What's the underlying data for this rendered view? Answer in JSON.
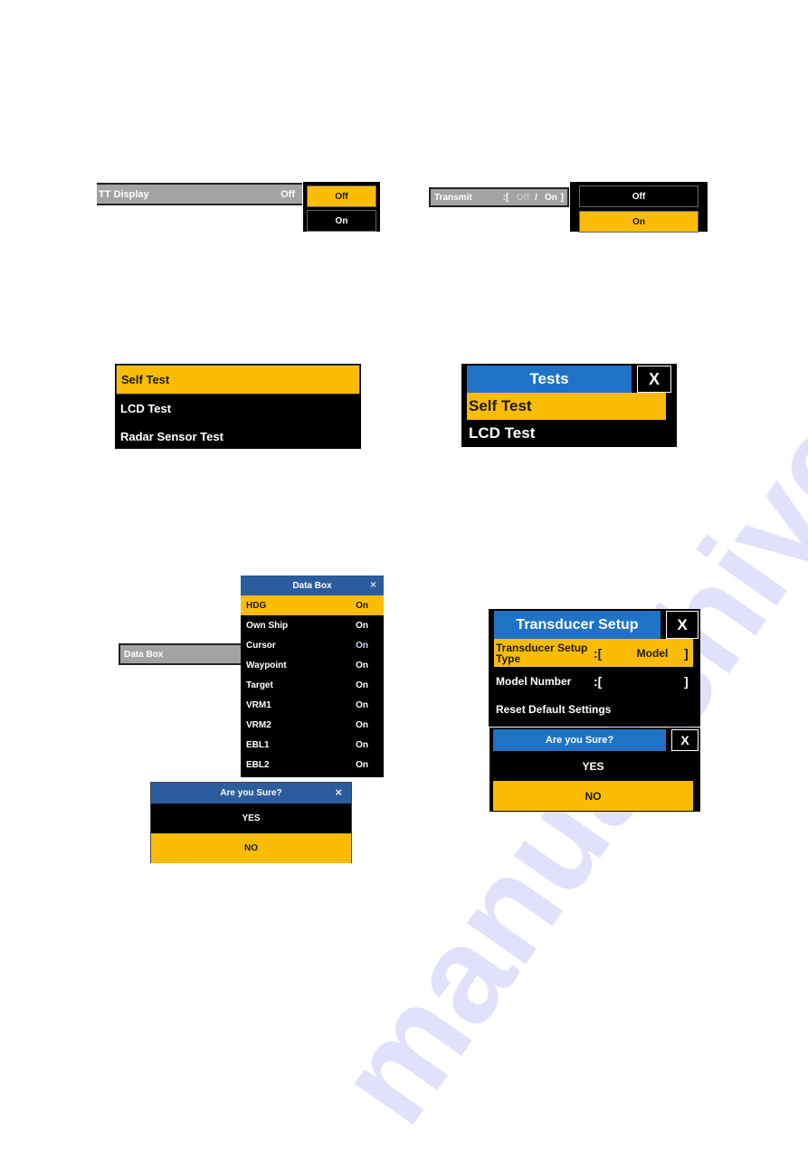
{
  "watermark": "manualshive.com",
  "colors": {
    "selected": "#fbbc05",
    "header_blue": "#1f73c6",
    "header_navy": "#2a5c9e",
    "bar_gray": "#a3a3a3"
  },
  "tt_display": {
    "label": "TT Display",
    "value": "Off",
    "options": [
      {
        "label": "Off",
        "selected": true
      },
      {
        "label": "On",
        "selected": false
      }
    ]
  },
  "transmit": {
    "label": "Transmit",
    "open_bracket": ":[",
    "option_off": "Off",
    "separator": "/",
    "option_on": "On",
    "close_bracket": "]",
    "options": [
      {
        "label": "Off",
        "selected": false
      },
      {
        "label": "On",
        "selected": true
      }
    ]
  },
  "test_list": {
    "items": [
      {
        "label": "Self Test",
        "selected": true
      },
      {
        "label": "LCD Test",
        "selected": false
      },
      {
        "label": "Radar Sensor Test",
        "selected": false
      }
    ]
  },
  "tests_dialog": {
    "title": "Tests",
    "close": "X",
    "items": [
      {
        "label": "Self Test",
        "selected": true
      },
      {
        "label": "LCD Test",
        "selected": false
      }
    ]
  },
  "data_box": {
    "bar_label": "Data Box",
    "title": "Data Box",
    "close": "×",
    "rows": [
      {
        "label": "HDG",
        "value": "On"
      },
      {
        "label": "Own Ship",
        "value": "On"
      },
      {
        "label": "Cursor",
        "value": "On"
      },
      {
        "label": "Waypoint",
        "value": "On"
      },
      {
        "label": "Target",
        "value": "On"
      },
      {
        "label": "VRM1",
        "value": "On"
      },
      {
        "label": "VRM2",
        "value": "On"
      },
      {
        "label": "EBL1",
        "value": "On"
      },
      {
        "label": "EBL2",
        "value": "On"
      }
    ]
  },
  "confirm_1": {
    "title": "Are you Sure?",
    "close": "×",
    "yes": "YES",
    "no": "NO"
  },
  "transducer_setup": {
    "title": "Transducer Setup",
    "close": "X",
    "rows": [
      {
        "label": "Transducer Setup Type",
        "open": ":[",
        "value": "Model",
        "close": "]"
      },
      {
        "label": "Model Number",
        "open": ":[",
        "value": "",
        "close": "]"
      },
      {
        "label": "Reset Default Settings"
      }
    ]
  },
  "confirm_2": {
    "title": "Are you Sure?",
    "close": "X",
    "yes": "YES",
    "no": "NO"
  }
}
